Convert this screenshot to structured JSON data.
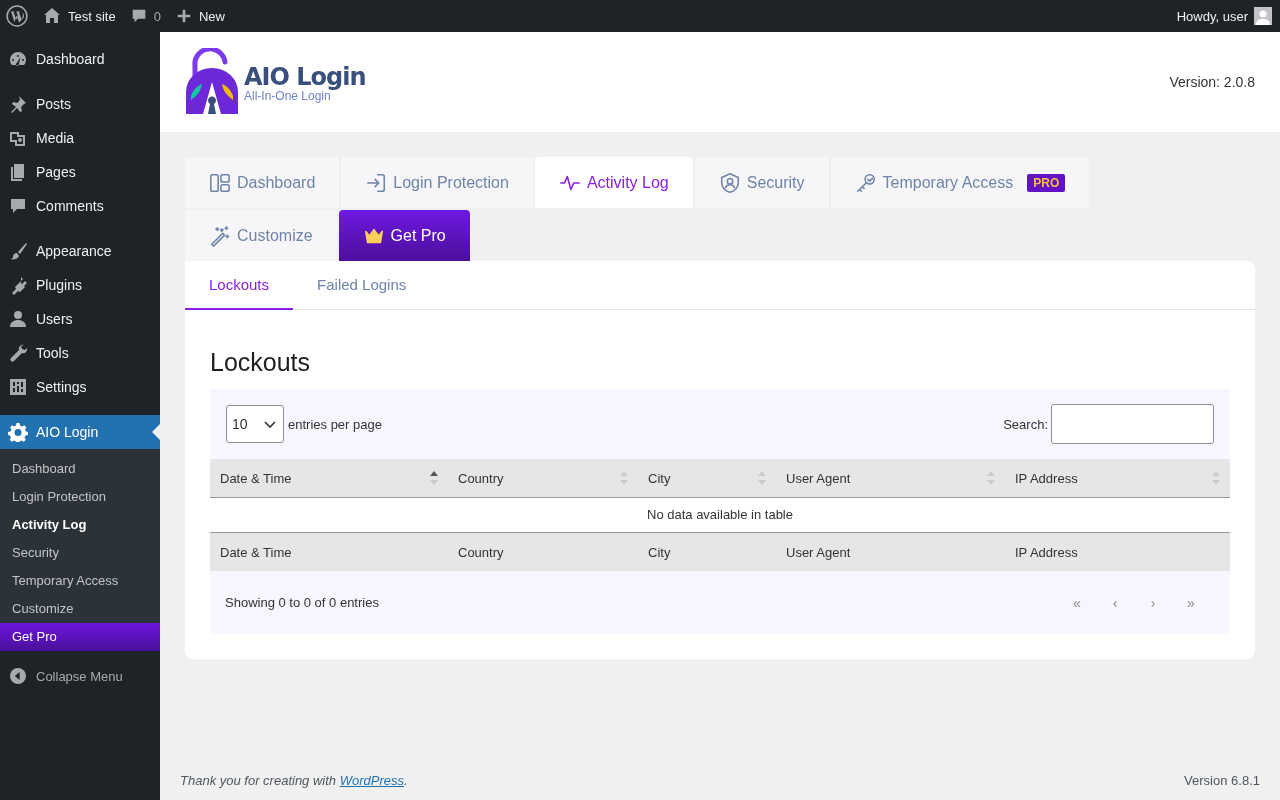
{
  "admin_bar": {
    "site": "Test site",
    "comments": "0",
    "new": "New",
    "greeting": "Howdy, user"
  },
  "menu": {
    "groups": [
      [
        {
          "label": "Dashboard",
          "selected": false
        }
      ],
      [
        {
          "label": "Posts",
          "selected": false
        },
        {
          "label": "Media",
          "selected": false
        },
        {
          "label": "Pages",
          "selected": false
        },
        {
          "label": "Comments",
          "selected": false
        }
      ],
      [
        {
          "label": "Appearance",
          "selected": false
        },
        {
          "label": "Plugins",
          "selected": false
        },
        {
          "label": "Users",
          "selected": false
        },
        {
          "label": "Tools",
          "selected": false
        },
        {
          "label": "Settings",
          "selected": false
        }
      ],
      [
        {
          "label": "AIO Login",
          "selected": true
        }
      ]
    ],
    "submenu": [
      {
        "label": "Dashboard",
        "selected": false,
        "kind": "normal"
      },
      {
        "label": "Login Protection",
        "selected": false,
        "kind": "normal"
      },
      {
        "label": "Activity Log",
        "selected": true,
        "kind": "normal"
      },
      {
        "label": "Security",
        "selected": false,
        "kind": "normal"
      },
      {
        "label": "Temporary Access",
        "selected": false,
        "kind": "normal"
      },
      {
        "label": "Customize",
        "selected": false,
        "kind": "normal"
      },
      {
        "label": "Get Pro",
        "selected": false,
        "kind": "pro"
      }
    ],
    "collapse": "Collapse Menu"
  },
  "header": {
    "logo_title": "AIO Login",
    "logo_subtitle": "All-In-One Login",
    "version": "Version: 2.0.8"
  },
  "tabs": [
    {
      "label": "Dashboard",
      "selected": false,
      "kind": "normal"
    },
    {
      "label": "Login Protection",
      "selected": false,
      "kind": "normal"
    },
    {
      "label": "Activity Log",
      "selected": true,
      "kind": "normal"
    },
    {
      "label": "Security",
      "selected": false,
      "kind": "normal"
    },
    {
      "label": "Temporary Access",
      "selected": false,
      "kind": "normal",
      "badge": "PRO"
    },
    {
      "label": "Customize",
      "selected": false,
      "kind": "normal"
    },
    {
      "label": "Get Pro",
      "selected": false,
      "kind": "pro"
    }
  ],
  "subtabs": [
    {
      "label": "Lockouts",
      "selected": true
    },
    {
      "label": "Failed Logins",
      "selected": false
    }
  ],
  "panel": {
    "title": "Lockouts",
    "page_length": "10",
    "page_length_label": "entries per page",
    "search_label": "Search:",
    "columns": [
      {
        "label": "Date & Time",
        "sorted": true
      },
      {
        "label": "Country",
        "sorted": false
      },
      {
        "label": "City",
        "sorted": false
      },
      {
        "label": "User Agent",
        "sorted": false
      },
      {
        "label": "IP Address",
        "sorted": false
      }
    ],
    "empty": "No data available in table",
    "footer_columns": [
      "Date & Time",
      "Country",
      "City",
      "User Agent",
      "IP Address"
    ],
    "info": "Showing 0 to 0 of 0 entries",
    "pager": [
      {
        "label": "«",
        "disabled": true
      },
      {
        "label": "‹",
        "disabled": true
      },
      {
        "label": "›",
        "disabled": true
      },
      {
        "label": "»",
        "disabled": true
      }
    ]
  },
  "footer": {
    "thanks": "Thank you for creating with",
    "link": "WordPress",
    "after": ".",
    "version": "Version 6.8.1"
  }
}
